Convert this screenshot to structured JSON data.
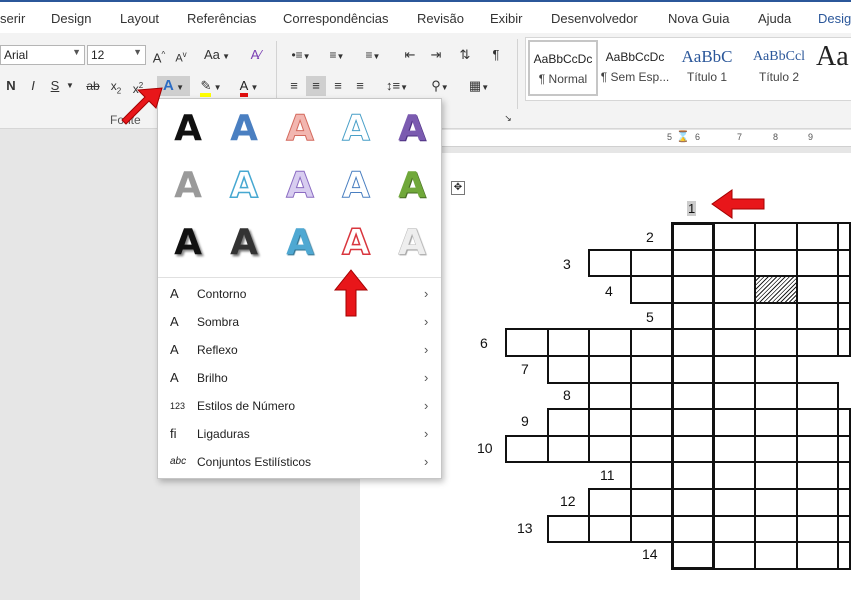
{
  "tabs": [
    {
      "label": "serir",
      "active": false
    },
    {
      "label": "Design",
      "active": false
    },
    {
      "label": "Layout",
      "active": false
    },
    {
      "label": "Referências",
      "active": false
    },
    {
      "label": "Correspondências",
      "active": false
    },
    {
      "label": "Revisão",
      "active": false
    },
    {
      "label": "Exibir",
      "active": false
    },
    {
      "label": "Desenvolvedor",
      "active": false
    },
    {
      "label": "Nova Guia",
      "active": false
    },
    {
      "label": "Ajuda",
      "active": false
    },
    {
      "label": "Desig",
      "active": true
    }
  ],
  "font": {
    "name": "Arial",
    "size": "12",
    "group_label": "Fonte",
    "case_label": "Aa"
  },
  "styles": [
    {
      "preview": "AaBbCcDc",
      "label": "¶ Normal",
      "selected": true
    },
    {
      "preview": "AaBbCcDc",
      "label": "¶ Sem Esp...",
      "selected": false
    },
    {
      "preview": "AaBbC",
      "label": "Título 1",
      "selected": false
    },
    {
      "preview": "AaBbCcl",
      "label": "Título 2",
      "selected": false
    },
    {
      "preview": "Aa",
      "label": "",
      "selected": false
    }
  ],
  "text_effects": {
    "glyph": "A",
    "menu": [
      {
        "icon": "A",
        "label": "Contorno"
      },
      {
        "icon": "A",
        "label": "Sombra"
      },
      {
        "icon": "A",
        "label": "Reflexo"
      },
      {
        "icon": "A",
        "label": "Brilho"
      },
      {
        "icon": "123",
        "label": "Estilos de Número"
      },
      {
        "icon": "fi",
        "label": "Ligaduras"
      },
      {
        "icon": "abc",
        "label": "Conjuntos Estilísticos"
      }
    ]
  },
  "ruler_marks": [
    "5",
    "6",
    "7",
    "8",
    "9"
  ],
  "crossword": {
    "numbers": [
      "1",
      "2",
      "3",
      "4",
      "5",
      "6",
      "7",
      "8",
      "9",
      "10",
      "11",
      "12",
      "13",
      "14"
    ]
  },
  "colors": {
    "accent": "#2b579a",
    "arrow": "#e8161a",
    "highlight": "#ffff00",
    "font_color": "#e01010"
  }
}
